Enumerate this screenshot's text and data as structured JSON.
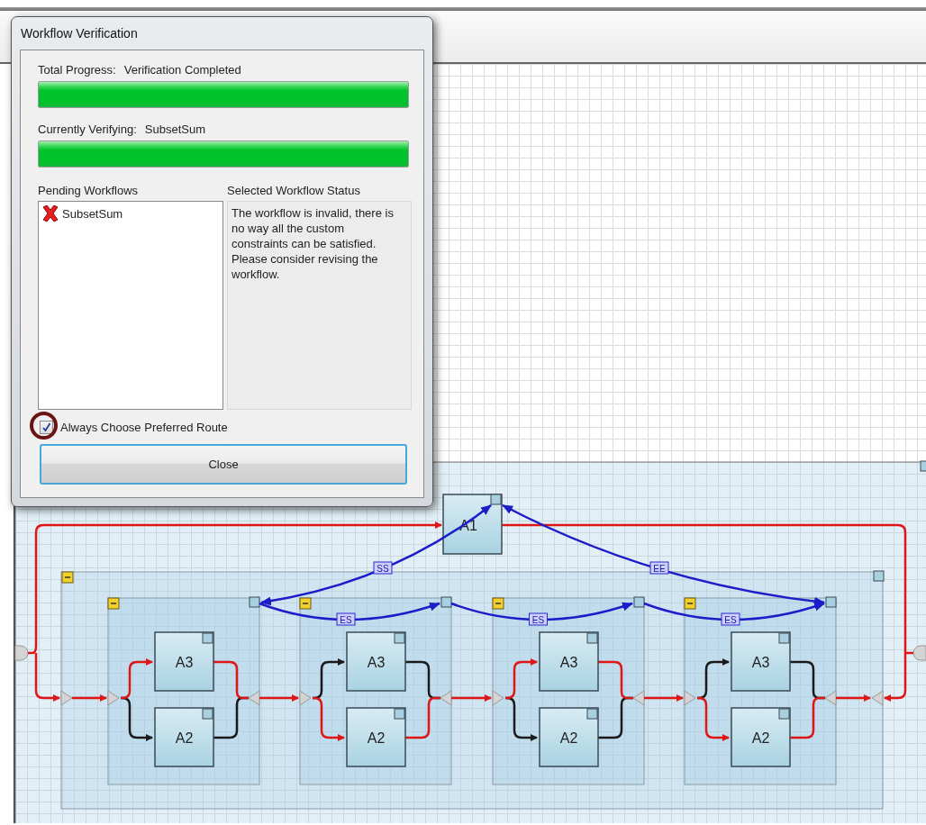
{
  "dialog": {
    "title": "Workflow Verification",
    "progress": [
      {
        "label": "Total Progress:",
        "value": "Verification Completed",
        "level": 1
      },
      {
        "label": "Currently Verifying:",
        "value": "SubsetSum",
        "level": 1
      }
    ],
    "pending": {
      "title": "Pending Workflows",
      "items": [
        {
          "name": "SubsetSum",
          "error": true,
          "selected": false
        }
      ]
    },
    "status": {
      "title": "Selected Workflow Status",
      "text": "The workflow is invalid, there is no way all the custom constraints can be satisfied. Please consider revising the workflow."
    },
    "preferred_route": {
      "label": "Always Choose Preferred Route",
      "checked": true
    },
    "close_button": "Close"
  },
  "diagram": {
    "root": {
      "label": "A1"
    },
    "root_links": [
      {
        "label": "SS"
      },
      {
        "label": "EE"
      }
    ],
    "main_group": {
      "expanded": true
    },
    "groups": [
      {
        "expanded": true,
        "branches": [
          {
            "label": "A3",
            "selected": true
          },
          {
            "label": "A2",
            "selected": false
          }
        ]
      },
      {
        "expanded": true,
        "prev_link": "ES",
        "branches": [
          {
            "label": "A3",
            "selected": false
          },
          {
            "label": "A2",
            "selected": true
          }
        ]
      },
      {
        "expanded": true,
        "prev_link": "ES",
        "branches": [
          {
            "label": "A3",
            "selected": true
          },
          {
            "label": "A2",
            "selected": false
          }
        ]
      },
      {
        "expanded": true,
        "prev_link": "ES",
        "branches": [
          {
            "label": "A3",
            "selected": false
          },
          {
            "label": "A2",
            "selected": true
          }
        ]
      }
    ]
  }
}
